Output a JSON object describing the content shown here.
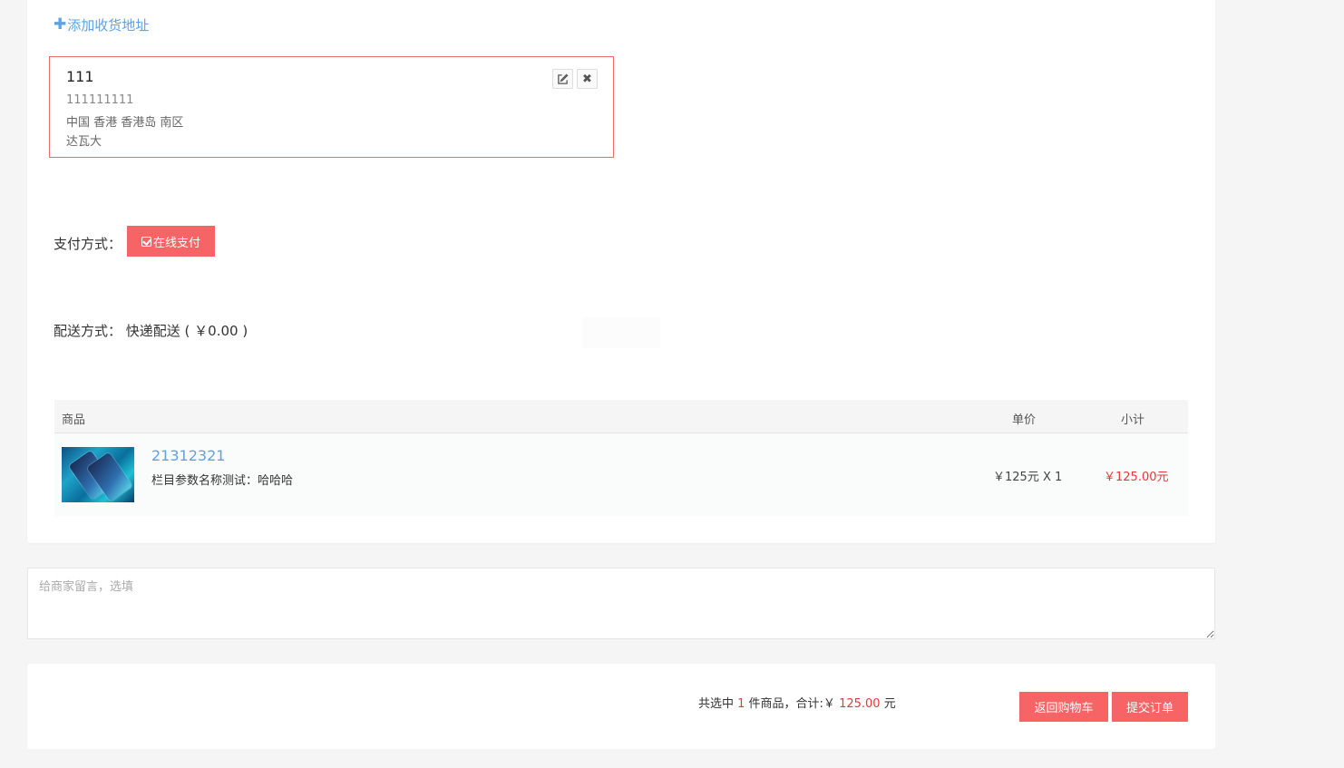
{
  "address": {
    "add_label": "添加收货地址",
    "name": "111",
    "phone": "111111111",
    "region": "中国 香港 香港岛 南区",
    "detail": "达瓦大",
    "delete_glyph": "✖"
  },
  "payment": {
    "label": "支付方式：",
    "method": "在线支付"
  },
  "shipping": {
    "label": "配送方式：  快递配送 ( ￥0.00 )"
  },
  "table": {
    "headers": {
      "goods": "商品",
      "price": "单价",
      "subtotal": "小计"
    },
    "rows": [
      {
        "name": "21312321",
        "spec": "栏目参数名称测试：哈哈哈",
        "price": "￥125元 X 1",
        "subtotal": "￥125.00元"
      }
    ]
  },
  "remark": {
    "placeholder": "给商家留言，选填"
  },
  "summary": {
    "prefix": "共选中 ",
    "count": "1",
    "mid": " 件商品，合计:￥ ",
    "total": "125.00",
    "suffix": " 元"
  },
  "buttons": {
    "back": "返回购物车",
    "submit": "提交订单"
  },
  "colors": {
    "accent": "#f66466",
    "link": "#5ea1e6",
    "price_red": "#e4393c"
  }
}
